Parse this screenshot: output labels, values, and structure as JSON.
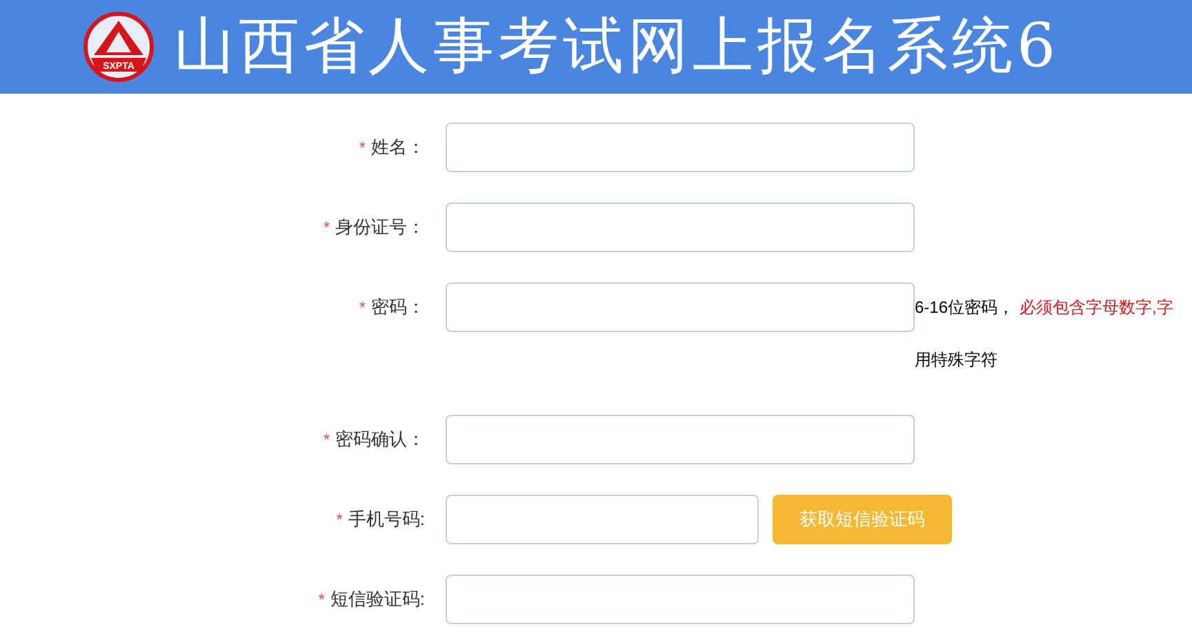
{
  "header": {
    "logo_text": "SXPTA",
    "title": "山西省人事考试网上报名系统6"
  },
  "fields": [
    {
      "kind": "text",
      "required_mark": "*",
      "label": "姓名："
    },
    {
      "kind": "text",
      "required_mark": "*",
      "label": "身份证号："
    },
    {
      "kind": "password",
      "required_mark": "*",
      "label": "密码：",
      "hint": "6-16位密码，",
      "hint_warning": "必须包含字母数字,字",
      "hint_line2": "用特殊字符"
    },
    {
      "kind": "text",
      "required_mark": "*",
      "label": "密码确认："
    },
    {
      "kind": "sms",
      "required_mark": "*",
      "label": "手机号码:",
      "button": "获取短信验证码"
    },
    {
      "kind": "text",
      "required_mark": "*",
      "label": "短信验证码:"
    }
  ]
}
